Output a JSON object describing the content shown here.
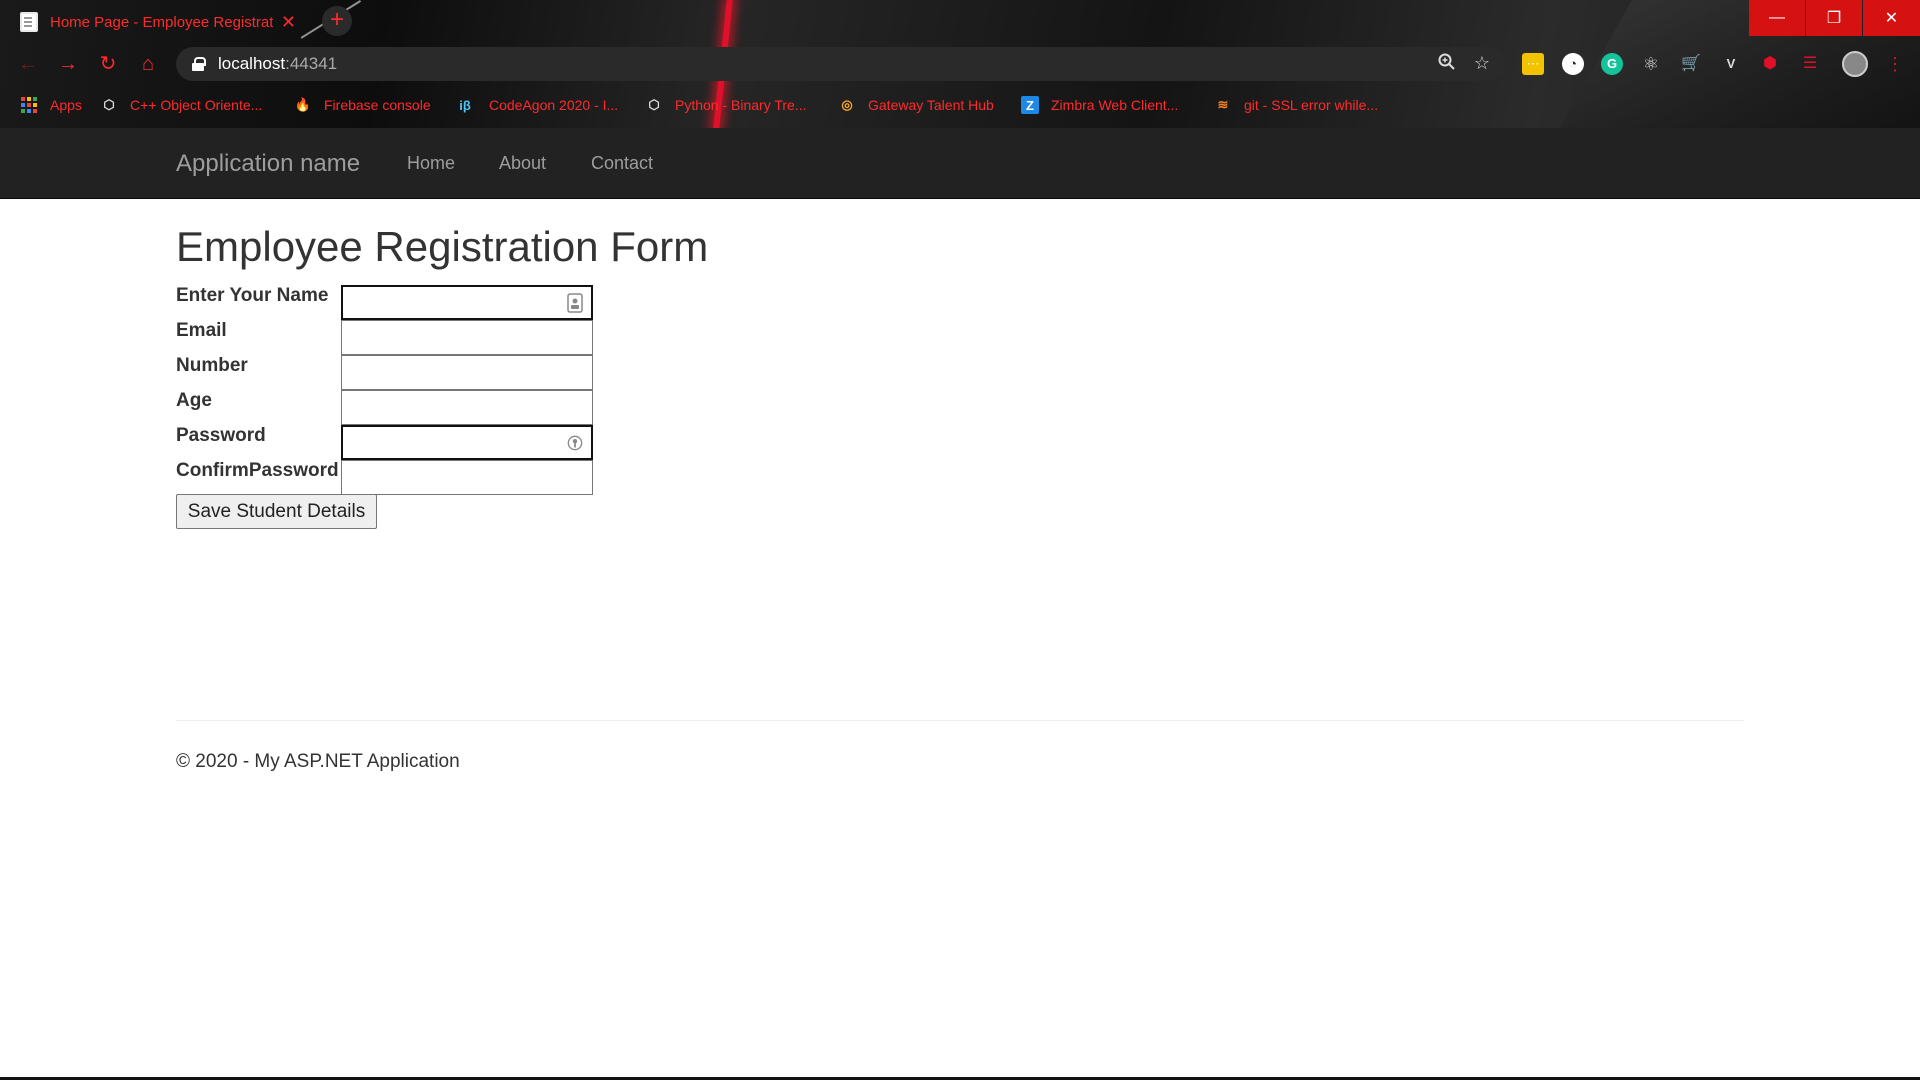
{
  "browser": {
    "tab_title": "Home Page - Employee Registrat",
    "tab_close": "✕",
    "new_tab": "+",
    "url_host": "localhost",
    "url_port": ":44341",
    "window_controls": {
      "minimize": "—",
      "maximize": "❐",
      "close": "✕"
    },
    "bookmarks": [
      {
        "label": "Apps",
        "icon": "apps-grid-icon"
      },
      {
        "label": "C++ Object Oriente...",
        "icon": "cube-icon"
      },
      {
        "label": "Firebase console",
        "icon": "firebase-flame-icon"
      },
      {
        "label": "CodeAgon 2020 - I...",
        "icon": "ib-logo-icon"
      },
      {
        "label": "Python - Binary Tre...",
        "icon": "cube-icon"
      },
      {
        "label": "Gateway Talent Hub",
        "icon": "gateway-logo-icon"
      },
      {
        "label": "Zimbra Web Client...",
        "icon": "zimbra-z-icon"
      },
      {
        "label": "git - SSL error while...",
        "icon": "stackoverflow-icon"
      }
    ]
  },
  "navbar": {
    "brand": "Application name",
    "links": [
      "Home",
      "About",
      "Contact"
    ]
  },
  "page": {
    "title": "Employee Registration Form",
    "fields": [
      {
        "label": "Enter Your Name",
        "value": ""
      },
      {
        "label": "Email",
        "value": ""
      },
      {
        "label": "Number",
        "value": ""
      },
      {
        "label": "Age",
        "value": ""
      },
      {
        "label": "Password",
        "value": ""
      },
      {
        "label": "ConfirmPassword",
        "value": ""
      }
    ],
    "submit_label": "Save Student Details",
    "footer": "© 2020 - My ASP.NET Application"
  },
  "colors": {
    "accent_red": "#ff2b2b",
    "navbar_bg": "#222222",
    "navbar_text": "#9d9d9d"
  }
}
